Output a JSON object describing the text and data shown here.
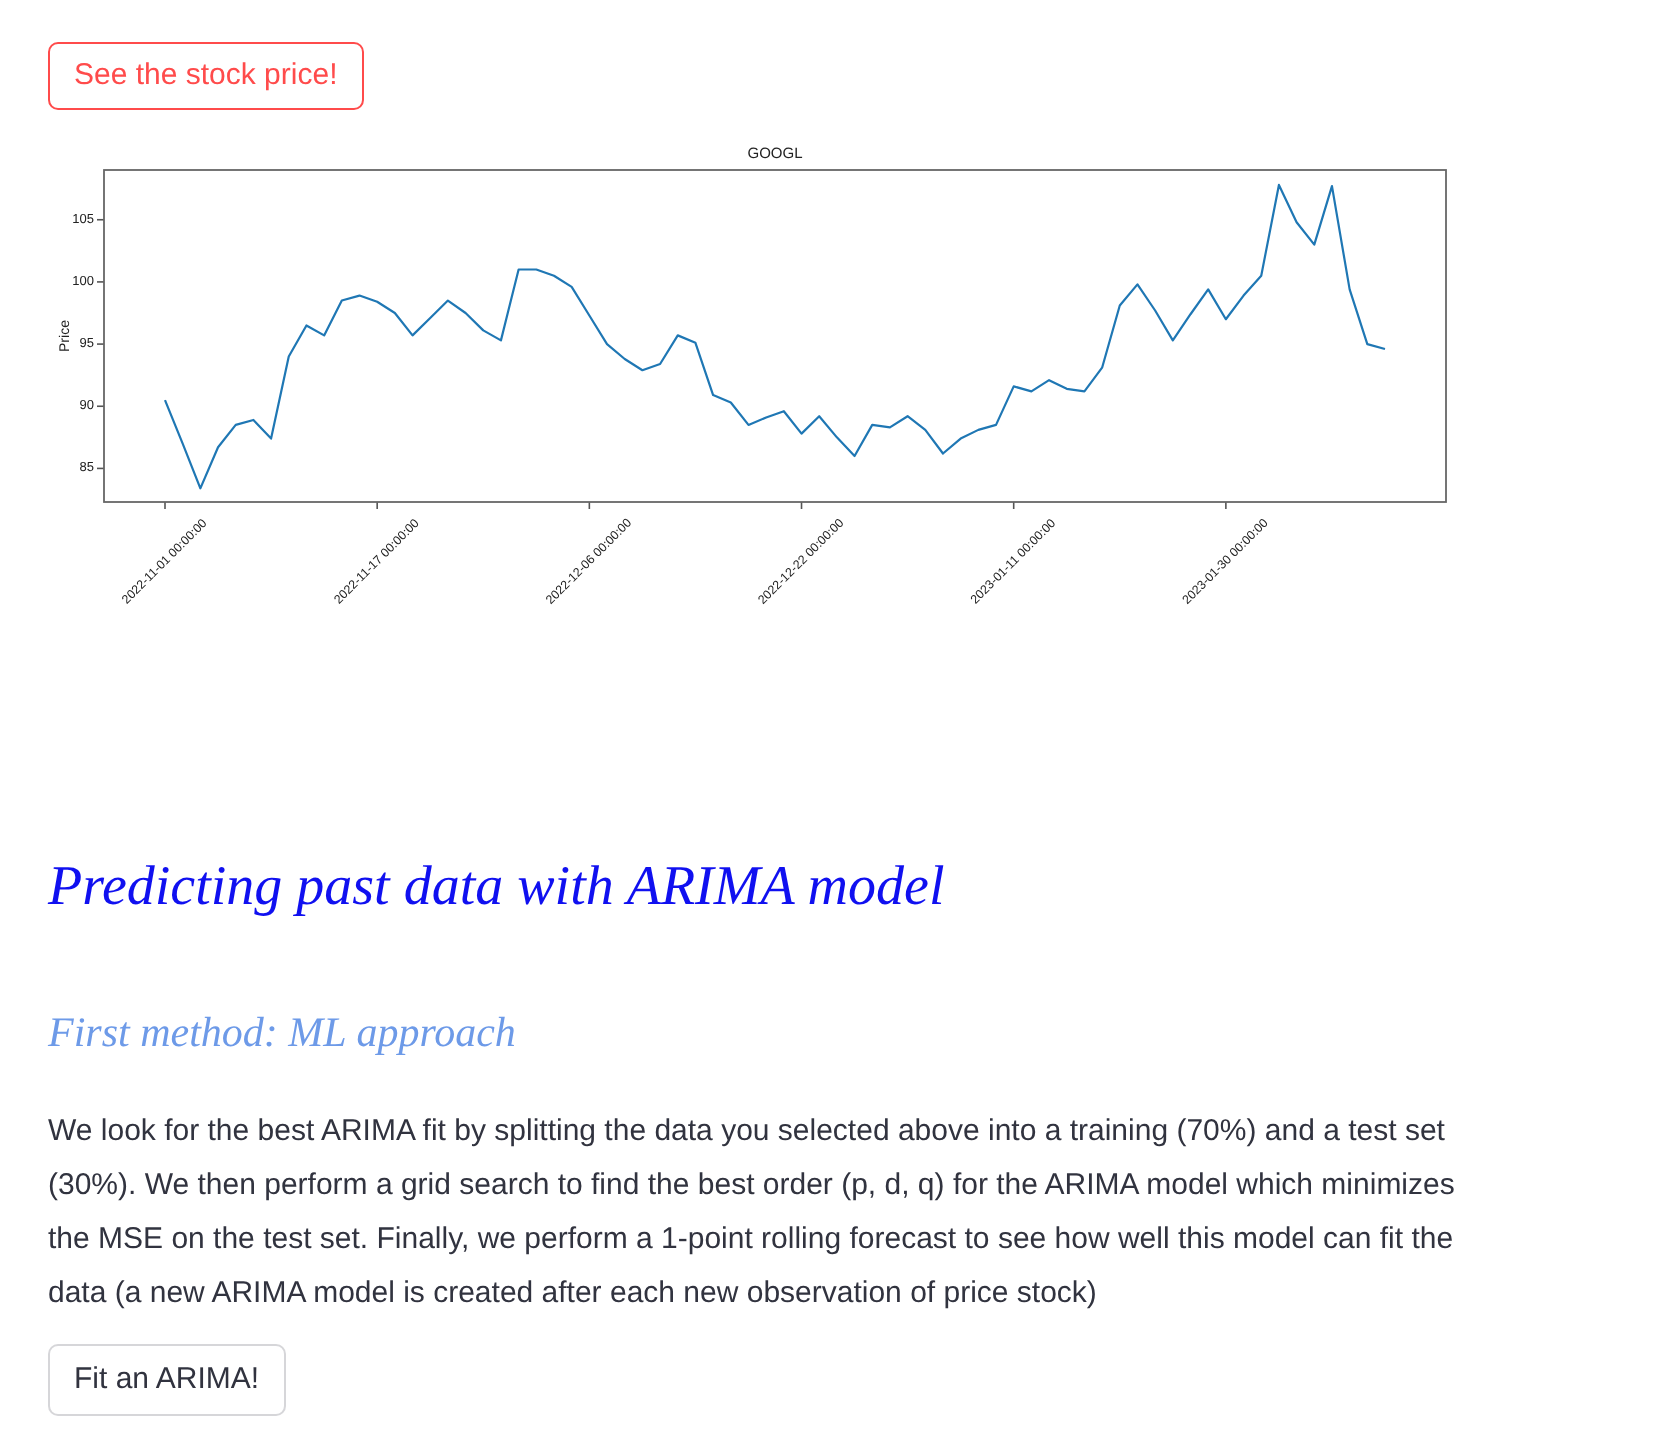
{
  "stock_button": {
    "label": "See the stock price!",
    "focused": true
  },
  "chart": {
    "chart_data": {
      "type": "line",
      "title": "GOOGL",
      "ylabel": "Price",
      "categories": [
        "2022-11-01 00:00:00",
        null,
        null,
        null,
        null,
        null,
        null,
        null,
        null,
        null,
        null,
        null,
        "2022-11-17 00:00:00",
        null,
        null,
        null,
        null,
        null,
        null,
        null,
        null,
        null,
        null,
        null,
        "2022-12-06 00:00:00",
        null,
        null,
        null,
        null,
        null,
        null,
        null,
        null,
        null,
        null,
        null,
        "2022-12-22 00:00:00",
        null,
        null,
        null,
        null,
        null,
        null,
        null,
        null,
        null,
        null,
        null,
        "2023-01-11 00:00:00",
        null,
        null,
        null,
        null,
        null,
        null,
        null,
        null,
        null,
        null,
        null,
        "2023-01-30 00:00:00",
        null,
        null,
        null,
        null,
        null,
        null,
        null,
        null,
        null
      ],
      "ylim": [
        82.3,
        109.0
      ],
      "yticks": [
        85,
        90,
        95,
        100,
        105
      ],
      "series": [
        {
          "color": "#1f77b4",
          "values": [
            90.5,
            87.0,
            83.4,
            86.7,
            88.5,
            88.9,
            87.4,
            94.0,
            96.5,
            95.7,
            98.5,
            98.9,
            98.4,
            97.5,
            95.7,
            97.1,
            98.5,
            97.5,
            96.1,
            95.3,
            101.0,
            101.0,
            100.5,
            99.6,
            97.3,
            95.0,
            93.8,
            92.9,
            93.4,
            95.7,
            95.1,
            90.9,
            90.3,
            88.5,
            89.1,
            89.6,
            87.8,
            89.2,
            87.5,
            86.0,
            88.5,
            88.3,
            89.2,
            88.1,
            86.2,
            87.4,
            88.1,
            88.5,
            91.6,
            91.2,
            92.1,
            91.4,
            91.2,
            93.1,
            98.1,
            99.8,
            97.7,
            95.3,
            97.4,
            99.4,
            97.0,
            98.9,
            100.5,
            107.8,
            104.8,
            103.0,
            107.7,
            99.4,
            95.0,
            94.6
          ]
        }
      ]
    }
  },
  "heading": "Predicting past data with ARIMA model",
  "subheading": "First method: ML approach",
  "paragraph": "We look for the best ARIMA fit by splitting the data you selected above into a training (70%) and a test set (30%). We then perform a grid search to find the best order (p, d, q) for the ARIMA model which minimizes the MSE on the test set. Finally, we perform a 1-point rolling forecast to see how well this model can fit the data (a new ARIMA model is created after each new observation of price stock)",
  "fit_button": {
    "label": "Fit an ARIMA!",
    "focused": false
  }
}
